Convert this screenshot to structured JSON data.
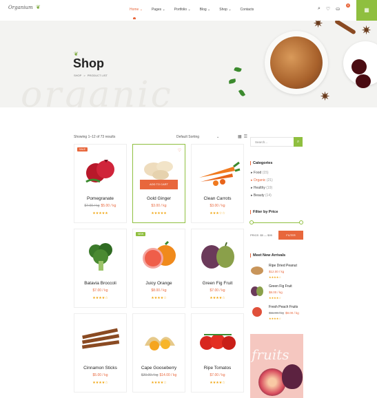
{
  "header": {
    "logo": "Organium",
    "nav": [
      "Home",
      "Pages",
      "Portfolio",
      "Blog",
      "Shop",
      "Contacts"
    ],
    "nav_active": "Home",
    "icons": [
      "search-icon",
      "heart-icon",
      "cart-icon"
    ],
    "cart_count": "0",
    "menu_icon": "grid-icon"
  },
  "banner": {
    "title": "Shop",
    "breadcrumb": [
      "SHOP",
      ">",
      "PRODUCT LIST"
    ],
    "watermark": "organic"
  },
  "toolbar": {
    "showing": "Showing 1–12 of 73 results",
    "sort": "Default Sorting",
    "view_icons": [
      "grid-view-icon",
      "list-view-icon"
    ]
  },
  "products": [
    {
      "name": "Pomegranate",
      "old_price": "$7.00 / kg",
      "price": "$5.00 / kg",
      "stars": "★★★★★",
      "badge": "SALE"
    },
    {
      "name": "Gold Ginger",
      "price": "$3.00 / kg",
      "stars": "★★★★★",
      "add_to_cart": "ADD TO CART"
    },
    {
      "name": "Clean Carrots",
      "price": "$3.00 / kg",
      "stars": "★★★☆☆"
    },
    {
      "name": "Batavia Broccoli",
      "price": "$7.00 / kg",
      "stars": "★★★★☆"
    },
    {
      "name": "Juicy Orange",
      "price": "$8.00 / kg",
      "stars": "★★★★☆",
      "badge": "NEW"
    },
    {
      "name": "Green Fig Fruit",
      "price": "$7.00 / kg",
      "stars": "★★★★☆"
    },
    {
      "name": "Cinnamon Sticks",
      "price": "$5.00 / kg",
      "stars": "★★★★☆"
    },
    {
      "name": "Cape Gooseberry",
      "old_price": "$20.00 / kg",
      "price": "$14.00 / kg",
      "stars": "★★★★☆"
    },
    {
      "name": "Ripe Tomatos",
      "price": "$7.00 / kg",
      "stars": "★★★★☆"
    }
  ],
  "sidebar": {
    "search_placeholder": "Search...",
    "categories_title": "Categories",
    "categories": [
      {
        "name": "Food",
        "count": "(15)"
      },
      {
        "name": "Organic",
        "count": "(21)"
      },
      {
        "name": "Healthy",
        "count": "(19)"
      },
      {
        "name": "Beauty",
        "count": "(14)"
      }
    ],
    "price_title": "Filter by Price",
    "price_range": "PRICE: $5 — $95",
    "filter_label": "FILTER",
    "arrivals_title": "Meet New Arrivals",
    "arrivals": [
      {
        "name": "Ripe Dried Peanut",
        "price": "$12.00 / kg",
        "stars": "★★★★☆"
      },
      {
        "name": "Green Fig Fruit",
        "price": "$8.00 / kg",
        "stars": "★★★★☆"
      },
      {
        "name": "Fresh Peach Fruits",
        "old_price": "$11.00 / kg",
        "price": "$8.00 / kg",
        "stars": "★★★★☆"
      }
    ],
    "promo_word": "fruits"
  },
  "colors": {
    "accent": "#e8673c",
    "brand_green": "#8fbf3f",
    "star": "#f0a30a"
  }
}
